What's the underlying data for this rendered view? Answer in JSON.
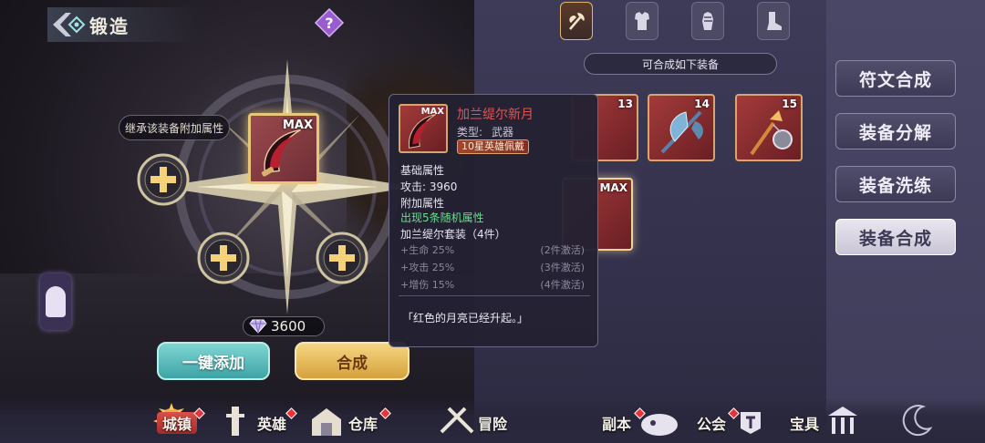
{
  "header": {
    "title": "锻造"
  },
  "forge": {
    "inherit_label": "继承该装备附加属性",
    "main_slot_tag": "MAX",
    "cost": "3600",
    "auto_add_label": "一键添加",
    "craft_label": "合成"
  },
  "panel": {
    "list_title": "可合成如下装备",
    "items": [
      {
        "level": "13"
      },
      {
        "level": "14"
      },
      {
        "level": "15"
      }
    ],
    "selected_tag": "MAX"
  },
  "tooltip": {
    "tag": "MAX",
    "name": "加兰缇尔新月",
    "type_label": "类型:",
    "type_value": "武器",
    "badge": "10星英雄佩戴",
    "base_header": "基础属性",
    "attack": "攻击: 3960",
    "extra_header": "附加属性",
    "extra_line": "出现5条随机属性",
    "set_header": "加兰缇尔套装（4件）",
    "set_bonuses": [
      {
        "text": "+生命 25%",
        "activate": "(2件激活)"
      },
      {
        "text": "+攻击 25%",
        "activate": "(3件激活)"
      },
      {
        "text": "+增伤 15%",
        "activate": "(4件激活)"
      }
    ],
    "flavor": "「红色的月亮已经升起。」"
  },
  "menu": {
    "items": [
      "符文合成",
      "装备分解",
      "装备洗练",
      "装备合成"
    ],
    "active": "装备合成"
  },
  "bottom_nav": {
    "items": [
      "城镇",
      "英雄",
      "仓库",
      "冒险",
      "副本",
      "公会",
      "宝具"
    ],
    "active": "城镇"
  },
  "colors": {
    "accent_red": "#e45252",
    "green_text": "#66e08a",
    "gold_button": "#d6a13c",
    "teal_button": "#3ea3a6"
  }
}
